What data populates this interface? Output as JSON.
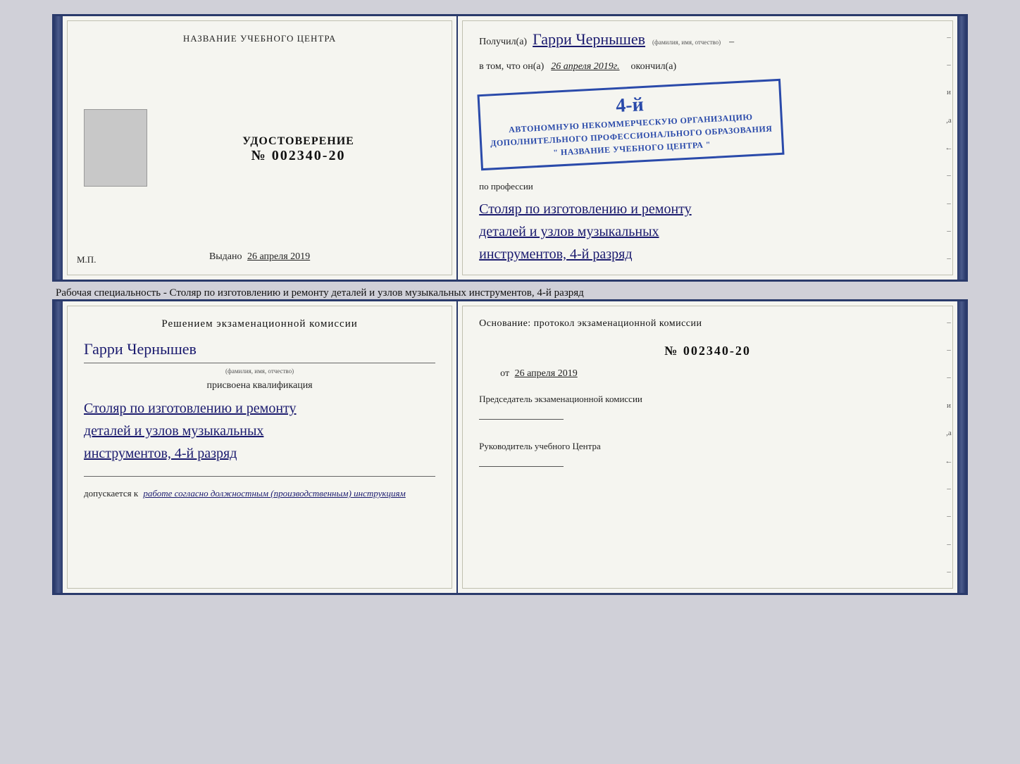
{
  "page": {
    "background_color": "#d0d0d8"
  },
  "upper_cert": {
    "left": {
      "school_name_label": "НАЗВАНИЕ УЧЕБНОГО ЦЕНТРА",
      "udostoverenie_label": "УДОСТОВЕРЕНИЕ",
      "number_prefix": "№",
      "number": "002340-20",
      "vydano_prefix": "Выдано",
      "vydano_date": "26 апреля 2019",
      "mp_label": "М.П."
    },
    "right": {
      "poluchil_label": "Получил(а)",
      "recipient_name": "Гарри Чернышев",
      "fio_label": "(фамилия, имя, отчество)",
      "vtom_label": "в том, что он(а)",
      "date_value": "26 апреля 2019г.",
      "okonchil_label": "окончил(а)",
      "stamp_line1": "АВТОНОМНУЮ НЕКОММЕРЧЕСКУЮ ОРГАНИЗАЦИЮ",
      "stamp_line2": "ДОПОЛНИТЕЛЬНОГО ПРОФЕССИОНАЛЬНОГО ОБРАЗОВАНИЯ",
      "stamp_line3": "\" НАЗВАНИЕ УЧЕБНОГО ЦЕНТРА \"",
      "stamp_4y": "4-й",
      "po_professii_label": "по профессии",
      "profession_line1": "Столяр по изготовлению и ремонту",
      "profession_line2": "деталей и узлов музыкальных",
      "profession_line3": "инструментов, 4-й разряд"
    }
  },
  "caption": {
    "text": "Рабочая специальность - Столяр по изготовлению и ремонту деталей и узлов музыкальных инструментов, 4-й разряд"
  },
  "lower_cert": {
    "left": {
      "resheniem_label": "Решением  экзаменационной  комиссии",
      "name_value": "Гарри Чернышев",
      "fio_label": "(фамилия, имя, отчество)",
      "prisvoyena_label": "присвоена квалификация",
      "qualification_line1": "Столяр по изготовлению и ремонту",
      "qualification_line2": "деталей и узлов музыкальных",
      "qualification_line3": "инструментов, 4-й разряд",
      "dopuskaetsya_prefix": "допускается к",
      "dopuskaetsya_value": "работе согласно должностным (производственным) инструкциям"
    },
    "right": {
      "osnova_label": "Основание: протокол экзаменационной  комиссии",
      "number_prefix": "№",
      "number": "002340-20",
      "ot_prefix": "от",
      "ot_date": "26 апреля 2019",
      "predsedatel_label": "Председатель экзаменационной комиссии",
      "rukovoditel_label": "Руководитель учебного Центра"
    }
  },
  "side_letters": {
    "right1": "–",
    "right2": "и",
    "right3": ",а",
    "right4": "←"
  }
}
